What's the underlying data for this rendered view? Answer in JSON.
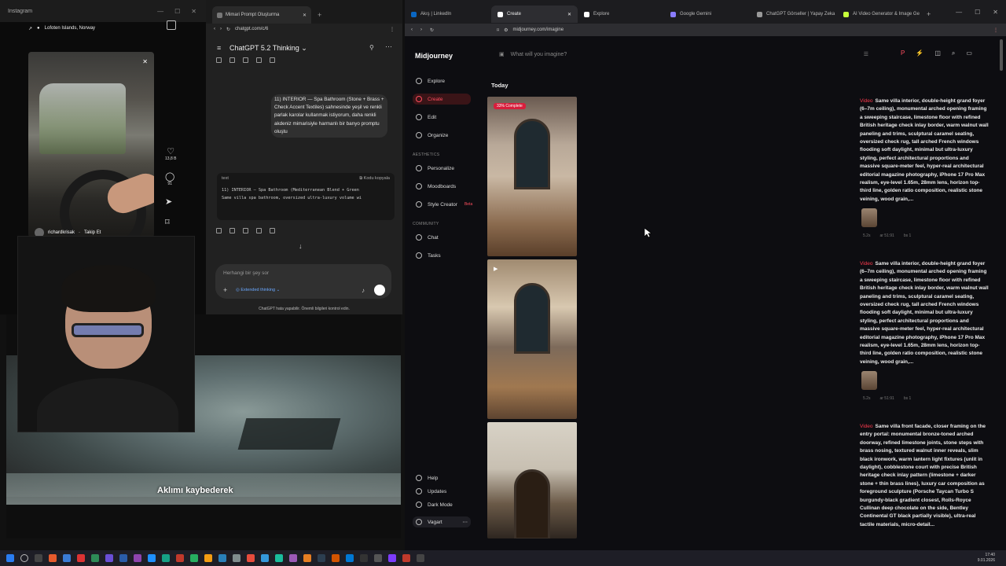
{
  "instagram": {
    "window_title": "Instagram",
    "location": "Lofoten Islands, Norway",
    "username": "richardkrisak",
    "follow": "Takip Et",
    "likes": "13,8 B",
    "comments": "91"
  },
  "chatgpt": {
    "tab_title": "Mimari Prompt Oluşturma",
    "url": "chatgpt.com/c/6",
    "model": "ChatGPT 5.2 Thinking",
    "user_message": "11) INTERIOR — Spa Bathroom (Stone + Brass + Check Accent Textiles) sahnesinde yeşil ve renkli parlak karolar kullanmak istiyorum, daha renkli akdeniz mimarisiyle harmanlı bir banyo promptu oluştu",
    "code_lang": "text",
    "copy_label": "Kodu kopyala",
    "code_lines": [
      "11) INTERIOR — Spa Bathroom (Mediterranean Blend + Green",
      "Same villa spa bathroom, oversized ultra-luxury volume wi"
    ],
    "input_placeholder": "Herhangi bir şey sor",
    "thinking_mode": "Extended thinking",
    "footer": "ChatGPT hata yapabilir. Önemli bilgileri kontrol edin."
  },
  "subtitle": "Aklımı kaybederek",
  "browser": {
    "tabs": [
      {
        "label": "Akış | LinkedIn",
        "active": false
      },
      {
        "label": "Create",
        "active": true
      },
      {
        "label": "Explore",
        "active": false
      },
      {
        "label": "Google Gemini",
        "active": false
      },
      {
        "label": "ChatGPT Görseller | Yapay Zeka",
        "active": false
      },
      {
        "label": "AI Video Generator & Image Ge",
        "active": false
      }
    ],
    "url": "midjourney.com/imagine"
  },
  "midjourney": {
    "logo": "Midjourney",
    "search_placeholder": "What will you imagine?",
    "nav": {
      "explore": "Explore",
      "create": "Create",
      "edit": "Edit",
      "organize": "Organize",
      "aesthetics_header": "AESTHETICS",
      "personalize": "Personalize",
      "moodboards": "Moodboards",
      "style_creator": "Style Creator",
      "beta": "Beta",
      "community_header": "COMMUNITY",
      "chat": "Chat",
      "tasks": "Tasks",
      "help": "Help",
      "updates": "Updates",
      "dark_mode": "Dark Mode",
      "user": "Vagart"
    },
    "section_title": "Today",
    "progress_badge": "33% Complete",
    "progress": 0.33,
    "prompts": [
      {
        "tag": "Video",
        "text": "Same villa interior, double-height grand foyer (6–7m ceiling), monumental arched opening framing a sweeping staircase, limestone floor with refined British heritage check inlay border, warm walnut wall paneling and trims, sculptural caramel seating, oversized check rug, tall arched French windows flooding soft daylight, minimal but ultra-luxury styling, perfect architectural proportions and massive square-meter feel, hyper-real architectural editorial magazine photography, iPhone 17 Pro Max realism, eye-level 1.65m, 28mm lens, horizon top-third line, golden ratio composition, realistic stone veining, wood grain,...",
        "meta": [
          "5.2s",
          "ar 51:91",
          "bs 1"
        ]
      },
      {
        "tag": "Video",
        "text": "Same villa interior, double-height grand foyer (6–7m ceiling), monumental arched opening framing a sweeping staircase, limestone floor with refined British heritage check inlay border, warm walnut wall paneling and trims, sculptural caramel seating, oversized check rug, tall arched French windows flooding soft daylight, minimal but ultra-luxury styling, perfect architectural proportions and massive square-meter feel, hyper-real architectural editorial magazine photography, iPhone 17 Pro Max realism, eye-level 1.65m, 28mm lens, horizon top-third line, golden ratio composition, realistic stone veining, wood grain,...",
        "meta": [
          "5.2s",
          "ar 51:91",
          "bs 1"
        ]
      },
      {
        "tag": "Video",
        "text": "Same villa front facade, closer framing on the entry portal: monumental bronze-toned arched doorway, refined limestone joints, stone steps with brass nosing, textured walnut inner reveals, slim black ironwork, warm lantern light fixtures (unlit in daylight), cobblestone court with precise British heritage check inlay pattern (limestone + darker stone + thin brass lines), luxury car composition as foreground sculpture (Porsche Taycan Turbo S burgundy-black gradient closest, Rolls-Royce Cullinan deep chocolate on the side, Bentley Continental GT black partially visible), ultra-real tactile materials, micro-detail...",
        "meta": []
      }
    ]
  },
  "taskbar": {
    "time": "17:40",
    "date": "9.01.2026"
  }
}
